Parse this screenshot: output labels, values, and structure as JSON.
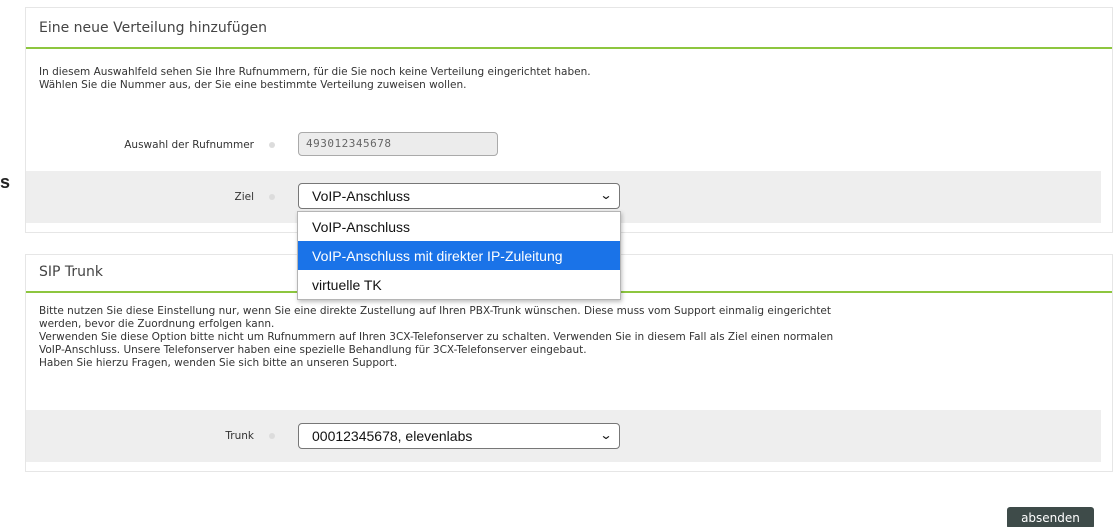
{
  "stray_char": "s",
  "section_distribution": {
    "title": "Eine neue Verteilung hinzufügen",
    "description_lines": [
      "In diesem Auswahlfeld sehen Sie Ihre Rufnummern, für die Sie noch keine Verteilung eingerichtet haben.",
      "Wählen Sie die Nummer aus, der Sie eine bestimmte Verteilung zuweisen wollen."
    ],
    "number_label": "Auswahl der Rufnummer",
    "number_value": "493012345678",
    "target_label": "Ziel",
    "target_value": "VoIP-Anschluss",
    "target_options": [
      "VoIP-Anschluss",
      "VoIP-Anschluss mit direkter IP-Zuleitung",
      "virtuelle TK"
    ],
    "highlighted_option": "VoIP-Anschluss mit direkter IP-Zuleitung"
  },
  "section_sip": {
    "title": "SIP Trunk",
    "description_lines": [
      "Bitte nutzen Sie diese Einstellung nur, wenn Sie eine direkte Zustellung auf Ihren PBX-Trunk wünschen. Diese muss vom Support einmalig eingerichtet",
      "werden, bevor die Zuordnung erfolgen kann.",
      "Verwenden Sie diese Option bitte nicht um Rufnummern auf Ihren 3CX-Telefonserver zu schalten. Verwenden Sie in diesem Fall als Ziel einen normalen",
      "VoIP-Anschluss. Unsere Telefonserver haben eine spezielle Behandlung für 3CX-Telefonserver eingebaut.",
      "Haben Sie hierzu Fragen, wenden Sie sich bitte an unseren Support."
    ],
    "trunk_label": "Trunk",
    "trunk_value": "00012345678, elevenlabs"
  },
  "submit_label": "absenden",
  "icons": {
    "select_arrow": "chevron-down-icon"
  },
  "colors": {
    "accent_line": "#8dc63f",
    "highlight": "#1a73e8",
    "button": "#3e4b49"
  }
}
